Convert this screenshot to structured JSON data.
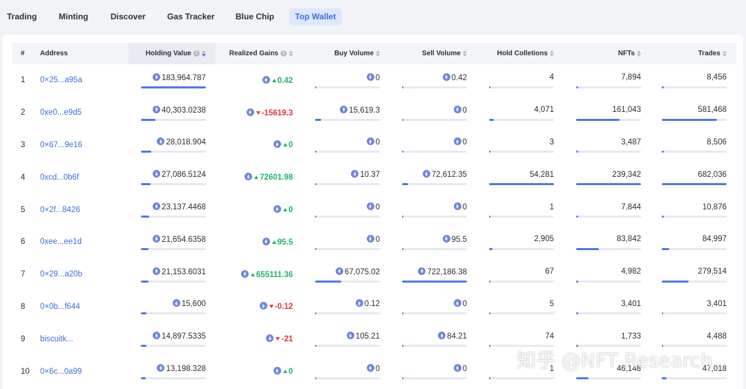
{
  "tabs": [
    {
      "label": "Trading",
      "active": false
    },
    {
      "label": "Minting",
      "active": false
    },
    {
      "label": "Discover",
      "active": false
    },
    {
      "label": "Gas Tracker",
      "active": false
    },
    {
      "label": "Blue Chip",
      "active": false
    },
    {
      "label": "Top Wallet",
      "active": true
    }
  ],
  "table": {
    "headers": {
      "rank": "#",
      "address": "Address",
      "holding_value": "Holding Value",
      "realized_gains": "Realized Gains",
      "buy_volume": "Buy Volume",
      "sell_volume": "Sell Volume",
      "hold_collections": "Hold Colletions",
      "nfts": "NFTs",
      "trades": "Trades"
    },
    "sorted_by": "holding_value",
    "sort_direction": "desc",
    "info_icon_glyph": "i",
    "rows": [
      {
        "rank": "1",
        "address": "0×25...a95a",
        "holding_value": "183,964.787",
        "holding_pct": 1.0,
        "gain_text": "0.42",
        "gain_dir": "up",
        "buy": "0",
        "buy_pct": 0.0,
        "sell": "0.42",
        "sell_pct": 0.0,
        "hold": "4",
        "hold_pct": 0.0,
        "nfts": "7,894",
        "nfts_pct": 0.03,
        "trades": "8,456",
        "trades_pct": 0.01
      },
      {
        "rank": "2",
        "address": "0xe0...e9d5",
        "holding_value": "40,303.0238",
        "holding_pct": 0.22,
        "gain_text": "-15619.3",
        "gain_dir": "down",
        "buy": "15,619.3",
        "buy_pct": 0.1,
        "sell": "0",
        "sell_pct": 0.0,
        "hold": "4,071",
        "hold_pct": 0.07,
        "nfts": "161,043",
        "nfts_pct": 0.67,
        "trades": "581,468",
        "trades_pct": 0.85
      },
      {
        "rank": "3",
        "address": "0×67...9e16",
        "holding_value": "28,018.904",
        "holding_pct": 0.16,
        "gain_text": "0",
        "gain_dir": "up",
        "buy": "0",
        "buy_pct": 0.0,
        "sell": "0",
        "sell_pct": 0.0,
        "hold": "3",
        "hold_pct": 0.0,
        "nfts": "3,487",
        "nfts_pct": 0.02,
        "trades": "8,506",
        "trades_pct": 0.01
      },
      {
        "rank": "4",
        "address": "0xcd...0b6f",
        "holding_value": "27,086.5124",
        "holding_pct": 0.15,
        "gain_text": "72601.98",
        "gain_dir": "up",
        "buy": "10.37",
        "buy_pct": 0.0,
        "sell": "72,612.35",
        "sell_pct": 0.1,
        "hold": "54,281",
        "hold_pct": 1.0,
        "nfts": "239,342",
        "nfts_pct": 1.0,
        "trades": "682,036",
        "trades_pct": 1.0
      },
      {
        "rank": "5",
        "address": "0×2f...8426",
        "holding_value": "23,137.4468",
        "holding_pct": 0.13,
        "gain_text": "0",
        "gain_dir": "up",
        "buy": "0",
        "buy_pct": 0.0,
        "sell": "0",
        "sell_pct": 0.0,
        "hold": "1",
        "hold_pct": 0.0,
        "nfts": "7,844",
        "nfts_pct": 0.03,
        "trades": "10,876",
        "trades_pct": 0.02
      },
      {
        "rank": "6",
        "address": "0xee...ee1d",
        "holding_value": "21,654.6358",
        "holding_pct": 0.12,
        "gain_text": "95.5",
        "gain_dir": "up",
        "buy": "0",
        "buy_pct": 0.0,
        "sell": "95.5",
        "sell_pct": 0.0,
        "hold": "2,905",
        "hold_pct": 0.05,
        "nfts": "83,842",
        "nfts_pct": 0.35,
        "trades": "84,997",
        "trades_pct": 0.12
      },
      {
        "rank": "7",
        "address": "0×29...a20b",
        "holding_value": "21,153.6031",
        "holding_pct": 0.12,
        "gain_text": "655111.36",
        "gain_dir": "up",
        "buy": "67,075.02",
        "buy_pct": 0.4,
        "sell": "722,186.38",
        "sell_pct": 1.0,
        "hold": "67",
        "hold_pct": 0.0,
        "nfts": "4,982",
        "nfts_pct": 0.02,
        "trades": "279,514",
        "trades_pct": 0.41
      },
      {
        "rank": "8",
        "address": "0×0b...f644",
        "holding_value": "15,600",
        "holding_pct": 0.08,
        "gain_text": "-0.12",
        "gain_dir": "down",
        "buy": "0.12",
        "buy_pct": 0.0,
        "sell": "0",
        "sell_pct": 0.0,
        "hold": "5",
        "hold_pct": 0.0,
        "nfts": "3,401",
        "nfts_pct": 0.01,
        "trades": "3,401",
        "trades_pct": 0.0
      },
      {
        "rank": "9",
        "address": "biscuitk...",
        "holding_value": "14,897.5335",
        "holding_pct": 0.08,
        "gain_text": "-21",
        "gain_dir": "down",
        "buy": "105.21",
        "buy_pct": 0.0,
        "sell": "84.21",
        "sell_pct": 0.0,
        "hold": "74",
        "hold_pct": 0.0,
        "nfts": "1,733",
        "nfts_pct": 0.01,
        "trades": "4,488",
        "trades_pct": 0.0
      },
      {
        "rank": "10",
        "address": "0×6c...0a99",
        "holding_value": "13,198.328",
        "holding_pct": 0.07,
        "gain_text": "0",
        "gain_dir": "up",
        "buy": "0",
        "buy_pct": 0.0,
        "sell": "0",
        "sell_pct": 0.0,
        "hold": "1",
        "hold_pct": 0.0,
        "nfts": "46,148",
        "nfts_pct": 0.19,
        "trades": "47,018",
        "trades_pct": 0.07
      }
    ]
  },
  "watermark": "知乎 @NFT Research",
  "colors": {
    "accent": "#4a7ae8",
    "link": "#3b6fd8",
    "gain_up": "#1fb46a",
    "gain_down": "#e2363f",
    "eth_icon": "#6f86d6"
  }
}
